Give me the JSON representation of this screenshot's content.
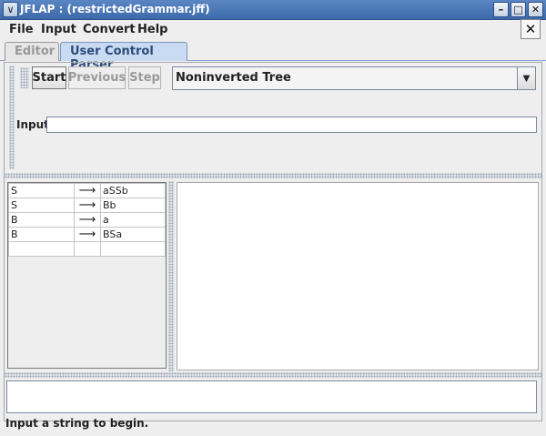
{
  "window": {
    "title": "JFLAP : (restrictedGrammar.jff)",
    "minimize_glyph": "–",
    "maximize_glyph": "□",
    "close_glyph": "✕",
    "system_menu_glyph": "∨"
  },
  "menubar": {
    "items": [
      "File",
      "Input",
      "Convert",
      "Help"
    ],
    "close_glyph": "✕"
  },
  "tabs": [
    {
      "label": "Editor",
      "active": false
    },
    {
      "label": "User Control Parser",
      "active": true
    }
  ],
  "toolbar": {
    "start_label": "Start",
    "previous_label": "Previous",
    "step_label": "Step",
    "view_selected": "Noninverted Tree",
    "dropdown_arrow": "▼"
  },
  "input": {
    "label": "Input",
    "value": ""
  },
  "grammar": {
    "productions": [
      {
        "lhs": "S",
        "arrow": "⟶",
        "rhs": "aSSb"
      },
      {
        "lhs": "S",
        "arrow": "⟶",
        "rhs": "Bb"
      },
      {
        "lhs": "B",
        "arrow": "⟶",
        "rhs": "a"
      },
      {
        "lhs": "B",
        "arrow": "⟶",
        "rhs": "BSa"
      },
      {
        "lhs": "",
        "arrow": "",
        "rhs": ""
      }
    ]
  },
  "status": {
    "message": "Input a string to begin."
  },
  "colors": {
    "accent": "#c9dbf2",
    "titlebar": "#4a78b8"
  }
}
